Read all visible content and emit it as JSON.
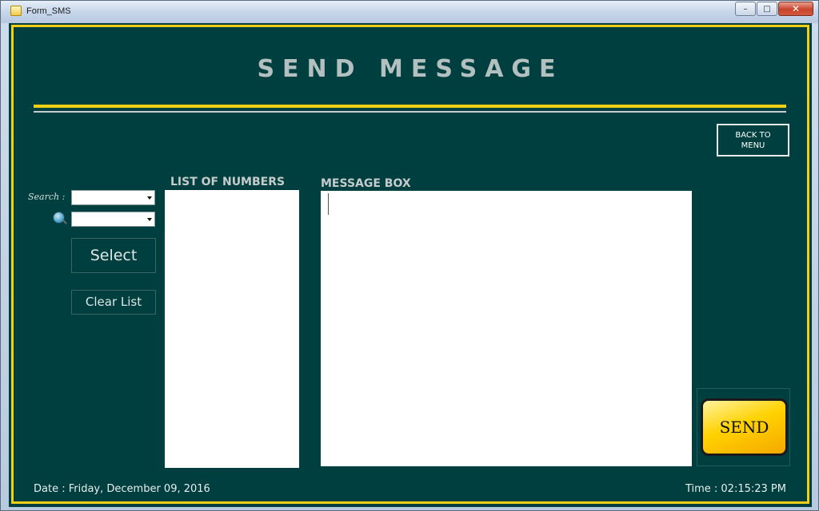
{
  "window": {
    "title": "Form_SMS",
    "minimize_glyph": "–",
    "maximize_glyph": "□",
    "close_glyph": "✕"
  },
  "heading": "SEND MESSAGE",
  "back_button": {
    "line1": "BACK TO",
    "line2": "MENU"
  },
  "search": {
    "label": "Search :"
  },
  "buttons": {
    "select": "Select",
    "clear_list": "Clear List",
    "send": "SEND"
  },
  "list": {
    "title": "LIST OF NUMBERS"
  },
  "message": {
    "title": "MESSAGE BOX"
  },
  "footer": {
    "date": "Date : Friday, December 09, 2016",
    "time": "Time : 02:15:23 PM"
  },
  "colors": {
    "background": "#003f3f",
    "accent": "#f0d017",
    "send_button": "#ffd200"
  },
  "icons": {
    "search": "magnifier-icon",
    "app": "app-icon"
  }
}
